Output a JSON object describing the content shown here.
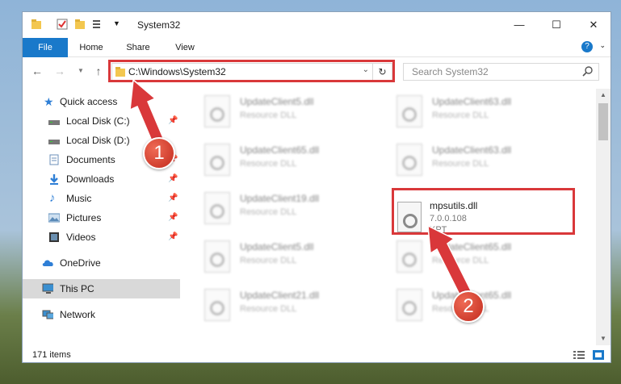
{
  "window": {
    "title": "System32"
  },
  "ribbon": {
    "tabs": [
      "File",
      "Home",
      "Share",
      "View"
    ]
  },
  "nav": {
    "address": "C:\\Windows\\System32",
    "search_placeholder": "Search System32"
  },
  "sidebar": {
    "items": [
      {
        "label": "Quick access",
        "icon": "star-icon",
        "color": "#2f7fd6"
      },
      {
        "label": "Local Disk (C:)",
        "icon": "drive-icon",
        "color": "#666666"
      },
      {
        "label": "Local Disk (D:)",
        "icon": "drive-icon",
        "color": "#666666"
      },
      {
        "label": "Documents",
        "icon": "documents-icon",
        "color": "#6b8fb8"
      },
      {
        "label": "Downloads",
        "icon": "download-icon",
        "color": "#2f7fd6"
      },
      {
        "label": "Music",
        "icon": "music-icon",
        "color": "#2f7fd6"
      },
      {
        "label": "Pictures",
        "icon": "pictures-icon",
        "color": "#5a8ab8"
      },
      {
        "label": "Videos",
        "icon": "videos-icon",
        "color": "#444444"
      },
      {
        "label": "OneDrive",
        "icon": "cloud-icon",
        "color": "#2f7fd6"
      },
      {
        "label": "This PC",
        "icon": "computer-icon",
        "color": "#3a8fd0"
      },
      {
        "label": "Network",
        "icon": "network-icon",
        "color": "#3a8fd0"
      }
    ]
  },
  "files": {
    "left": [
      {
        "name": "UpdateClient5.dll",
        "desc": "Resource DLL"
      },
      {
        "name": "UpdateClient65.dll",
        "desc": "Resource DLL"
      },
      {
        "name": "UpdateClient19.dll",
        "desc": "Resource DLL"
      },
      {
        "name": "UpdateClient5.dll",
        "desc": "Resource DLL"
      },
      {
        "name": "UpdateClient21.dll",
        "desc": "Resource DLL"
      }
    ],
    "right": [
      {
        "name": "UpdateClient63.dll",
        "desc": "Resource DLL"
      },
      {
        "name": "UpdateClient63.dll",
        "desc": "Resource DLL"
      },
      {
        "name": "UpdateClient65.dll",
        "desc": "Resource DLL"
      },
      {
        "name": "UpdateClient65.dll",
        "desc": "Resource DLL"
      }
    ],
    "highlight": {
      "name": "mpsutils.dll",
      "version": "7.0.0.108",
      "desc": "KPT"
    }
  },
  "status": {
    "count": "171 items"
  },
  "annotations": {
    "badge1": "1",
    "badge2": "2",
    "color": "#d9383a"
  }
}
